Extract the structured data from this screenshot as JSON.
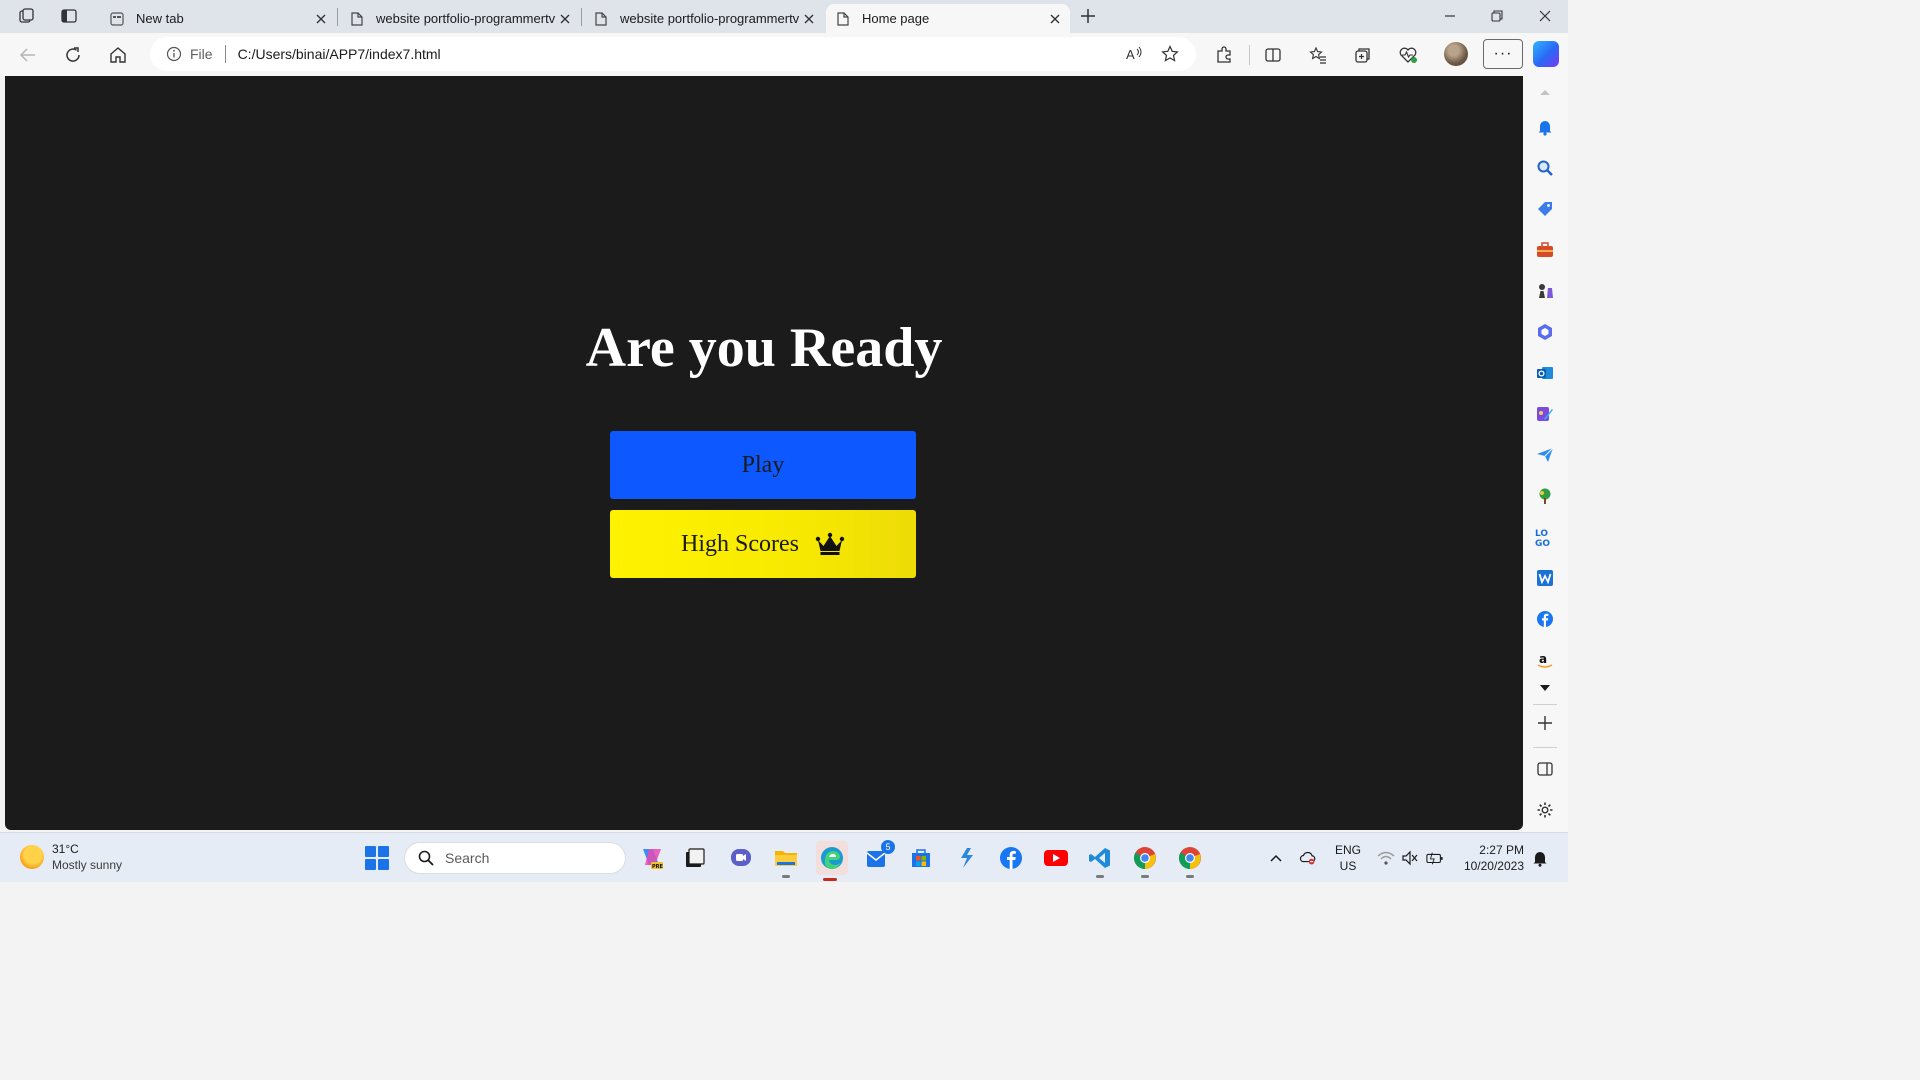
{
  "browser": {
    "tabs": [
      {
        "title": "New tab",
        "active": false
      },
      {
        "title": "website portfolio-programmertv",
        "active": false
      },
      {
        "title": "website portfolio-programmertv",
        "active": false
      },
      {
        "title": "Home page",
        "active": true
      }
    ],
    "address": {
      "scheme_label": "File",
      "url": "C:/Users/binai/APP7/index7.html"
    },
    "more_label": "···"
  },
  "page": {
    "heading": "Are you Ready",
    "play_label": "Play",
    "high_scores_label": "High Scores",
    "colors": {
      "background": "#1b1b1b",
      "play": "#0d58ff",
      "high_scores": "#fff200"
    }
  },
  "taskbar": {
    "weather": {
      "temp": "31°C",
      "condition": "Mostly sunny"
    },
    "search_placeholder": "Search",
    "mail_badge": "5",
    "language": {
      "line1": "ENG",
      "line2": "US"
    },
    "clock": {
      "time": "2:27 PM",
      "date": "10/20/2023"
    }
  }
}
